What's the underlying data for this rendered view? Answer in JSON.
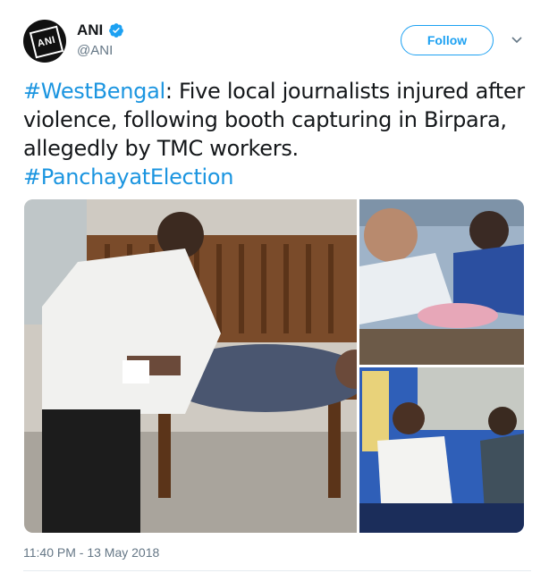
{
  "author": {
    "display_name": "ANI",
    "handle": "@ANI",
    "avatar_text": "ANI"
  },
  "follow_label": "Follow",
  "tweet": {
    "hashtag_1": "#WestBengal",
    "body": ": Five local journalists injured after violence, following booth capturing in Birpara, allegedly by TMC workers.",
    "hashtag_2": "#PanchayatElection"
  },
  "timestamp": "11:40 PM - 13 May 2018",
  "colors": {
    "accent": "#1da1f2",
    "hashtag": "#1b95e0",
    "muted": "#657786"
  },
  "icons": {
    "verified": "verified-badge-icon",
    "caret": "chevron-down-icon"
  }
}
